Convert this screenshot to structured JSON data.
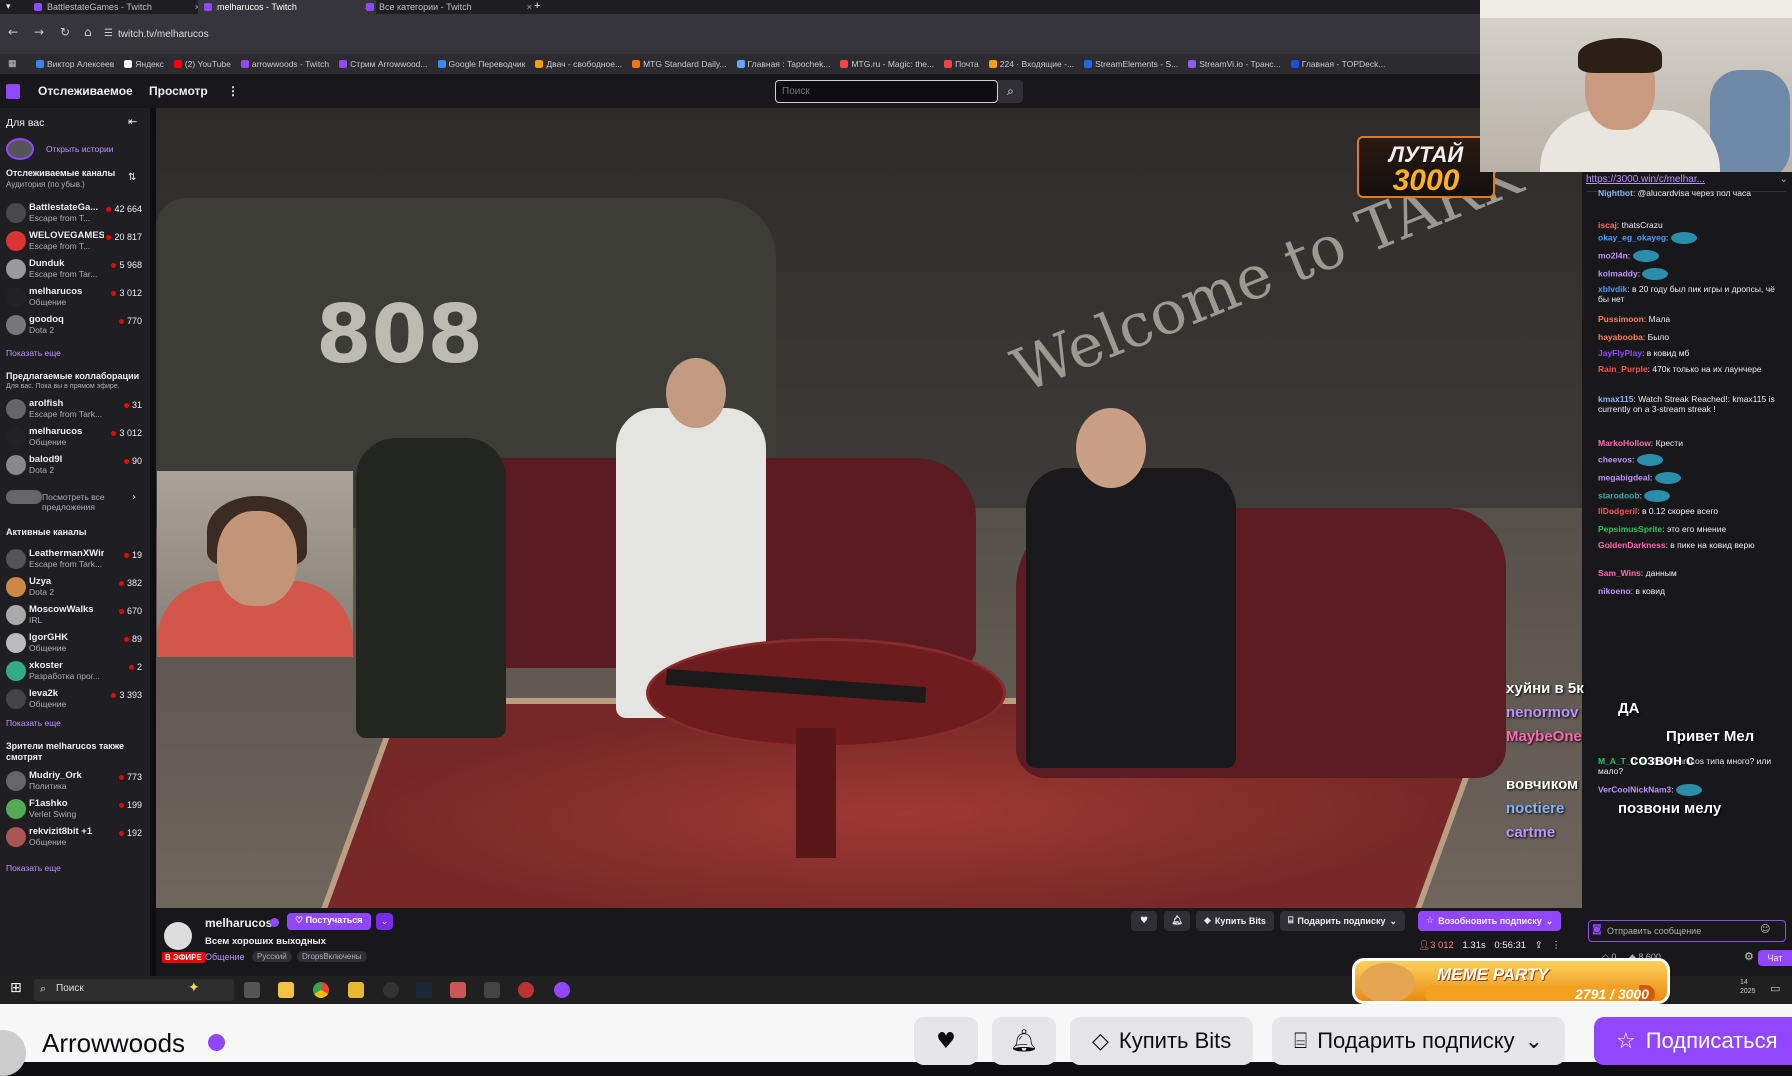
{
  "browser": {
    "tabs": [
      {
        "title": "BattlestateGames - Twitch",
        "active": false
      },
      {
        "title": "melharucos - Twitch",
        "active": true
      },
      {
        "title": "Все категории - Twitch",
        "active": false
      }
    ],
    "url": "twitch.tv/melharucos",
    "bookmarks": [
      {
        "label": "Виктор Алексеев",
        "color": "#3b82f6"
      },
      {
        "label": "Яндекс",
        "color": "#ffffff"
      },
      {
        "label": "(2) YouTube",
        "color": "#ff0000"
      },
      {
        "label": "arrowwoods - Twitch",
        "color": "#9147ff"
      },
      {
        "label": "Стрим Arrowwood...",
        "color": "#9147ff"
      },
      {
        "label": "Google Переводчик",
        "color": "#4285f4"
      },
      {
        "label": "Двач - свободное...",
        "color": "#f59e0b"
      },
      {
        "label": "MTG Standard Daily...",
        "color": "#f97316"
      },
      {
        "label": "Главная : Tapochek...",
        "color": "#60a5fa"
      },
      {
        "label": "MTG.ru - Magic: the...",
        "color": "#ef4444"
      },
      {
        "label": "Почта",
        "color": "#ef4444"
      },
      {
        "label": "224 · Входящие -...",
        "color": "#f59e0b"
      },
      {
        "label": "StreamElements - S...",
        "color": "#2563eb"
      },
      {
        "label": "StreamVi.io - Транс...",
        "color": "#8b5cf6"
      },
      {
        "label": "Главная - TOPDeck...",
        "color": "#1d4ed8"
      }
    ]
  },
  "topnav": {
    "following": "Отслеживаемое",
    "browse": "Просмотр",
    "more": "⋮",
    "search_placeholder": "Поиск"
  },
  "sidebar": {
    "for_you": "Для вас",
    "open_stories": "Открыть истории",
    "followed_title": "Отслеживаемые каналы",
    "followed_sub": "Аудитория (по убыв.)",
    "followed": [
      {
        "name": "BattlestateGa...",
        "game": "Escape from T...",
        "viewers": "42 664",
        "color": "#4a4a4a"
      },
      {
        "name": "WELOVEGAMES",
        "game": "Escape from T...",
        "viewers": "20 817",
        "color": "#d33"
      },
      {
        "name": "Dunduk",
        "game": "Escape from Tar...",
        "viewers": "5 968",
        "color": "#999"
      },
      {
        "name": "melharucos",
        "game": "Общение",
        "viewers": "3 012",
        "color": "#222"
      },
      {
        "name": "goodoq",
        "game": "Dota 2",
        "viewers": "770",
        "color": "#777"
      }
    ],
    "show_more_1": "Показать еще",
    "collab_title": "Предлагаемые коллаборации",
    "collab_sub": "Для вас. Пока вы в прямом эфире.",
    "collabs": [
      {
        "name": "arolfish",
        "game": "Escape from Tark...",
        "viewers": "31",
        "color": "#666"
      },
      {
        "name": "melharucos",
        "game": "Общение",
        "viewers": "3 012",
        "color": "#222"
      },
      {
        "name": "balod9l",
        "game": "Dota 2",
        "viewers": "90",
        "color": "#888"
      }
    ],
    "see_all": "Посмотреть все предложения",
    "active_title": "Активные каналы",
    "active": [
      {
        "name": "LeathermanXWires",
        "game": "Escape from Tark...",
        "viewers": "19",
        "color": "#555"
      },
      {
        "name": "Uzya",
        "game": "Dota 2",
        "viewers": "382",
        "color": "#c84"
      },
      {
        "name": "MoscowWalks",
        "game": "IRL",
        "viewers": "670",
        "color": "#aaa"
      },
      {
        "name": "IgorGHK",
        "game": "Общение",
        "viewers": "89",
        "color": "#bbb"
      },
      {
        "name": "xkoster",
        "game": "Разработка прог...",
        "viewers": "2",
        "color": "#3a8"
      },
      {
        "name": "leva2k",
        "game": "Общение",
        "viewers": "3 393",
        "color": "#444"
      }
    ],
    "show_more_2": "Показать еще",
    "viewers_also_title": "Зрители melharucos также смотрят",
    "also": [
      {
        "name": "Mudriy_Ork",
        "game": "Политика",
        "viewers": "773",
        "color": "#666"
      },
      {
        "name": "F1ashko",
        "game": "Verlet Swing",
        "viewers": "199",
        "color": "#5a5"
      },
      {
        "name": "rekvizit8bit +1",
        "game": "Общение",
        "viewers": "192",
        "color": "#a55"
      }
    ],
    "show_more_3": "Показать еще"
  },
  "video": {
    "sign_808": "808",
    "graffiti": "Welcome to TARK",
    "loot_line1": "ЛУТАЙ",
    "loot_line2": "3000"
  },
  "overlay_chat": [
    {
      "text": "хуйни в 5к",
      "color": "#ffffff"
    },
    {
      "text": "nenormov",
      "color": "#bf94ff"
    },
    {
      "text": "ДА",
      "color": "#ffffff"
    },
    {
      "text": "MaybeOne",
      "color": "#ff69b4"
    },
    {
      "text": "Привет Мел",
      "color": "#ffffff"
    },
    {
      "text": "созвон с",
      "color": "#ffffff"
    },
    {
      "text": "вовчиком",
      "color": "#ffffff"
    },
    {
      "text": "noctiere",
      "color": "#8ab4f8"
    },
    {
      "text": "позвони мелу",
      "color": "#ffffff"
    },
    {
      "text": "cartme",
      "color": "#bf94ff"
    }
  ],
  "chat": {
    "pinned_link": "https://3000.win/c/melhar...",
    "messages": [
      {
        "user": "Nightbot",
        "color": "#8ab4f8",
        "text": "@alucardvisa через пол часа"
      },
      {
        "user": "iscaj",
        "color": "#ff6b6b",
        "text": "thatsCrazu"
      },
      {
        "user": "okay_eg_okayeg",
        "color": "#4a9fff",
        "text": ""
      },
      {
        "user": "mo2l4n",
        "color": "#bf94ff",
        "text": ""
      },
      {
        "user": "kolmaddy",
        "color": "#bf94ff",
        "text": ""
      },
      {
        "user": "xblvdik",
        "color": "#4a9fff",
        "text": "в 20 году был пик игры и дропсы, чё бы нет"
      },
      {
        "user": "Pussimoon",
        "color": "#ff7f50",
        "text": "Мала"
      },
      {
        "user": "hayabooba",
        "color": "#ff7f50",
        "text": "Было"
      },
      {
        "user": "JayFlyPlay",
        "color": "#9147ff",
        "text": "в ковид мб"
      },
      {
        "user": "Rain_Purple",
        "color": "#ff4d4d",
        "text": "470к только на их лаунчере"
      },
      {
        "user": "kmax115",
        "color": "#8ab4f8",
        "text": "Watch Streak Reached!: kmax115 is currently on a 3-stream streak !"
      },
      {
        "user": "MarkoHollow",
        "color": "#ff69b4",
        "text": "Крести"
      },
      {
        "user": "cheevos",
        "color": "#bf94ff",
        "text": ""
      },
      {
        "user": "megabigdeal",
        "color": "#bf94ff",
        "text": ""
      },
      {
        "user": "starodoob",
        "color": "#4aa",
        "text": ""
      },
      {
        "user": "IlDodgeril",
        "color": "#ff4d4d",
        "text": "в 0.12 скорее всего"
      },
      {
        "user": "PepsimusSprite",
        "color": "#22c55e",
        "text": "это его мнение"
      },
      {
        "user": "GoldenDarkness",
        "color": "#ff69b4",
        "text": "в пике на ковид верю"
      },
      {
        "user": "Sam_Wins",
        "color": "#ff69b4",
        "text": "данным"
      },
      {
        "user": "nikoeno",
        "color": "#bf94ff",
        "text": "в ковид"
      },
      {
        "user": "M_A_T_U_L",
        "color": "#22c55e",
        "text": "@melharucos типа много? или мало?"
      },
      {
        "user": "VerCoolNickNam3",
        "color": "#bf94ff",
        "text": ""
      }
    ],
    "input_placeholder": "Отправить сообщение",
    "points": "0",
    "bits": "8 600",
    "chat_button": "Чат"
  },
  "stream_info": {
    "channel": "melharucos",
    "follow_label": "♡ Постучаться",
    "title": "Всем хороших выходных",
    "live": "В ЭФИРЕ",
    "category": "Общение",
    "tags": [
      "Русский",
      "DropsВключены"
    ],
    "viewers": "3 012",
    "hours": "1.31s",
    "uptime": "0:56:31",
    "buy_bits": "Купить Bits",
    "gift_sub": "Подарить подписку",
    "resub": "Возобновить подписку"
  },
  "meme_party": {
    "label": "MEME PARTY",
    "count": "2791 / 3000",
    "progress": 0.93
  },
  "taskbar": {
    "search": "Поиск",
    "date": "14\n2025"
  },
  "bottom": {
    "channel": "Arrowwoods",
    "buy_bits": "Купить Bits",
    "gift_sub": "Подарить подписку",
    "subscribe": "Подписаться"
  }
}
